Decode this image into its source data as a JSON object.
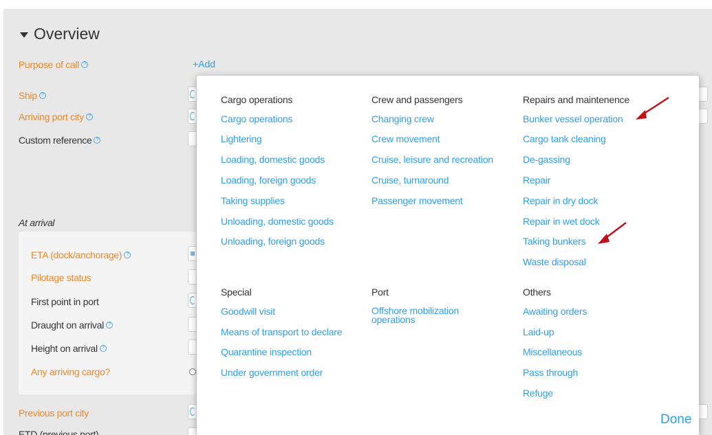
{
  "overview": {
    "title": "Overview"
  },
  "form": {
    "purpose_of_call": "Purpose of call",
    "add": "+Add",
    "ship": "Ship",
    "arriving_port_city": "Arriving port city",
    "custom_reference": "Custom reference",
    "at_arrival": "At arrival",
    "eta": "ETA (dock/anchorage)",
    "pilotage_status": "Pilotage status",
    "first_point_in_port": "First point in port",
    "draught_on_arrival": "Draught on arrival",
    "height_on_arrival": "Height on arrival",
    "any_arriving_cargo": "Any arriving cargo?",
    "previous_port_city": "Previous port city",
    "etd_previous_port": "ETD (previous port)"
  },
  "popup": {
    "columns": [
      {
        "heading": "Cargo operations",
        "items": [
          "Cargo operations",
          "Lightering",
          "Loading, domestic goods",
          "Loading, foreign goods",
          "Taking supplies",
          "Unloading, domestic goods",
          "Unloading, foreign goods"
        ]
      },
      {
        "heading": "Crew and passengers",
        "items": [
          "Changing crew",
          "Crew movement",
          "Cruise, leisure and recreation",
          "Cruise, turnaround",
          "Passenger movement"
        ]
      },
      {
        "heading": "Repairs and maintenence",
        "items": [
          "Bunker vessel operation",
          "Cargo tank cleaning",
          "De-gassing",
          "Repair",
          "Repair in dry dock",
          "Repair in wet dock",
          "Taking bunkers",
          "Waste disposal"
        ]
      },
      {
        "heading": "Special",
        "items": [
          "Goodwill visit",
          "Means of transport to declare",
          "Quarantine inspection",
          "Under government order"
        ]
      },
      {
        "heading": "Port",
        "items": [
          "Offshore mobilization operations"
        ]
      },
      {
        "heading": "Others",
        "items": [
          "Awaiting orders",
          "Laid-up",
          "Miscellaneous",
          "Pass through",
          "Refuge"
        ]
      }
    ],
    "done": "Done"
  },
  "colors": {
    "link": "#2f9fe0",
    "label_orange": "#e8892b",
    "annotation_arrow": "#c0111a"
  }
}
